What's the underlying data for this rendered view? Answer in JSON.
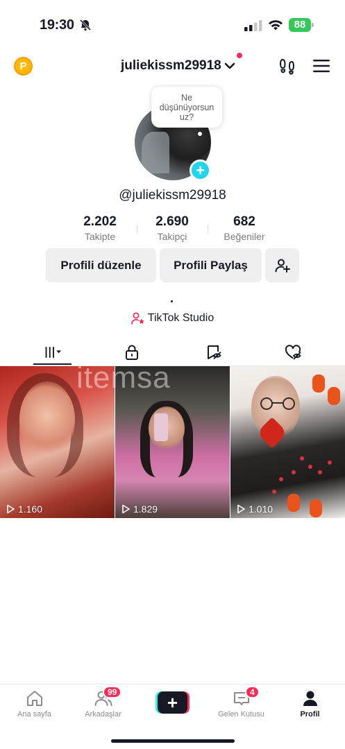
{
  "status_bar": {
    "time": "19:30",
    "battery": "88",
    "icons": [
      "bell-off-icon",
      "signal-icon",
      "wifi-icon",
      "battery-charging-icon"
    ]
  },
  "header": {
    "coin_label": "P",
    "username": "juliekissm29918",
    "icons": [
      "chevron-down-icon",
      "footprint-icon",
      "menu-icon"
    ]
  },
  "profile": {
    "bubble_text": "Ne düşünüyorsun uz?",
    "handle": "@juliekissm29918",
    "stats": [
      {
        "value": "2.202",
        "label": "Takipte"
      },
      {
        "value": "2.690",
        "label": "Takipçi"
      },
      {
        "value": "682",
        "label": "Beğeniler"
      }
    ],
    "buttons": {
      "edit": "Profili düzenle",
      "share": "Profili Paylaş"
    },
    "bio": ".",
    "studio_link": "TikTok Studio"
  },
  "tabs": [
    {
      "name": "videos-grid",
      "icon": "grid-icon",
      "active": true
    },
    {
      "name": "private",
      "icon": "lock-icon",
      "active": false
    },
    {
      "name": "reposts",
      "icon": "repost-icon",
      "active": false
    },
    {
      "name": "liked",
      "icon": "heart-hidden-icon",
      "active": false
    }
  ],
  "videos": [
    {
      "views": "1.160"
    },
    {
      "views": "1.829"
    },
    {
      "views": "1.010"
    }
  ],
  "watermark": "itemsa",
  "bottom_nav": [
    {
      "label": "Ana sayfa",
      "icon": "home-icon"
    },
    {
      "label": "Arkadaşlar",
      "icon": "friends-icon",
      "badge": "99"
    },
    {
      "label": "",
      "icon": "create-icon",
      "plus": "+"
    },
    {
      "label": "Gelen Kutusu",
      "icon": "inbox-icon",
      "badge": "4"
    },
    {
      "label": "Profil",
      "icon": "profile-icon",
      "active": true
    }
  ],
  "colors": {
    "accent": "#fe2c55",
    "cyan": "#25f4ee",
    "battery": "#34c759",
    "coin": "#ffb800",
    "text": "#161823"
  }
}
